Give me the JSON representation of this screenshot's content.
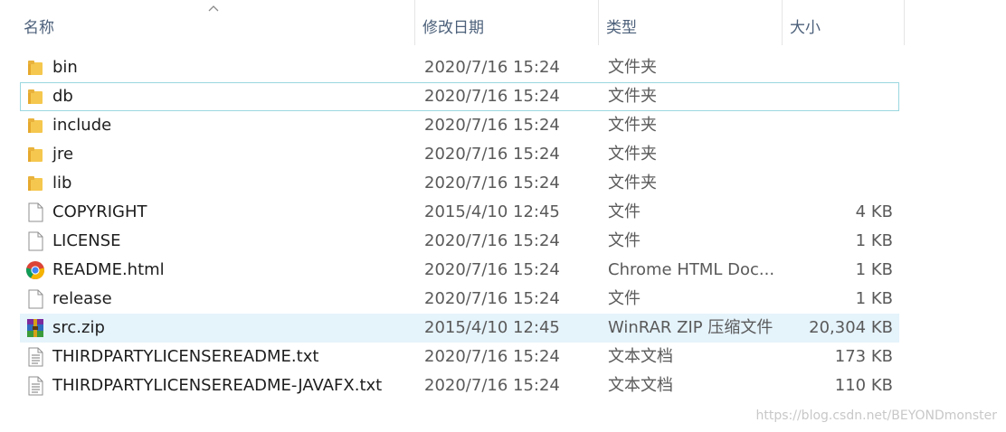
{
  "columns": {
    "name": "名称",
    "date": "修改日期",
    "type": "类型",
    "size": "大小"
  },
  "files": [
    {
      "name": "bin",
      "date": "2020/7/16 15:24",
      "type": "文件夹",
      "size": "",
      "icon": "folder-icon"
    },
    {
      "name": "db",
      "date": "2020/7/16 15:24",
      "type": "文件夹",
      "size": "",
      "icon": "folder-icon"
    },
    {
      "name": "include",
      "date": "2020/7/16 15:24",
      "type": "文件夹",
      "size": "",
      "icon": "folder-icon"
    },
    {
      "name": "jre",
      "date": "2020/7/16 15:24",
      "type": "文件夹",
      "size": "",
      "icon": "folder-icon"
    },
    {
      "name": "lib",
      "date": "2020/7/16 15:24",
      "type": "文件夹",
      "size": "",
      "icon": "folder-icon"
    },
    {
      "name": "COPYRIGHT",
      "date": "2015/4/10 12:45",
      "type": "文件",
      "size": "4 KB",
      "icon": "file-icon"
    },
    {
      "name": "LICENSE",
      "date": "2020/7/16 15:24",
      "type": "文件",
      "size": "1 KB",
      "icon": "file-icon"
    },
    {
      "name": "README.html",
      "date": "2020/7/16 15:24",
      "type": "Chrome HTML Doc...",
      "size": "1 KB",
      "icon": "chrome-icon"
    },
    {
      "name": "release",
      "date": "2020/7/16 15:24",
      "type": "文件",
      "size": "1 KB",
      "icon": "file-icon"
    },
    {
      "name": "src.zip",
      "date": "2015/4/10 12:45",
      "type": "WinRAR ZIP 压缩文件",
      "size": "20,304 KB",
      "icon": "winrar-icon"
    },
    {
      "name": "THIRDPARTYLICENSEREADME.txt",
      "date": "2020/7/16 15:24",
      "type": "文本文档",
      "size": "173 KB",
      "icon": "text-file-icon"
    },
    {
      "name": "THIRDPARTYLICENSEREADME-JAVAFX.txt",
      "date": "2020/7/16 15:24",
      "type": "文本文档",
      "size": "110 KB",
      "icon": "text-file-icon"
    }
  ],
  "watermark": "https://blog.csdn.net/BEYONDmonster",
  "colors": {
    "header_text": "#4c607a",
    "hover_bg": "#e5f3fb",
    "focus_border": "#9bd8e0",
    "folder": "#f5c74e"
  }
}
